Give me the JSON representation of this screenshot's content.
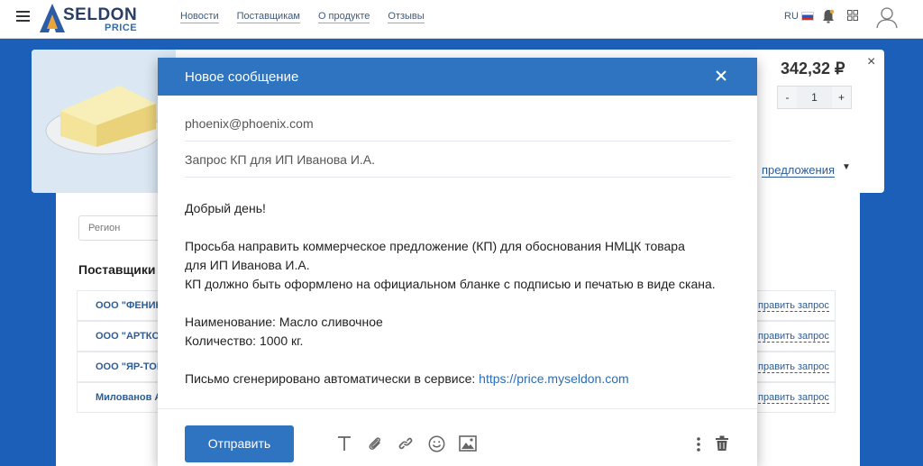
{
  "header": {
    "logo_name": "SELDON",
    "logo_sub": "PRICE",
    "nav": [
      "Новости",
      "Поставщикам",
      "О продукте",
      "Отзывы"
    ],
    "lang": "RU"
  },
  "product": {
    "price": "342,32 ₽",
    "quantity": "1",
    "minus": "-",
    "plus": "+",
    "offers_link": "предложения",
    "close_glyph": "×"
  },
  "filters": {
    "region_placeholder": "Регион"
  },
  "suppliers": {
    "title": "Поставщики",
    "rows": [
      {
        "name": "ООО \"ФЕНИК",
        "action": "править запрос"
      },
      {
        "name": "ООО \"АРТКО",
        "action": "править запрос"
      },
      {
        "name": "ООО \"ЯР-ТОР",
        "action": "править запрос"
      },
      {
        "name": "Милованов А",
        "action": "править запрос"
      }
    ]
  },
  "modal": {
    "title": "Новое сообщение",
    "to": "phoenix@phoenix.com",
    "subject": "Запрос КП для ИП Иванова И.А.",
    "greeting": "Добрый день!",
    "para1_line1": "Просьба направить коммерческое предложение (КП) для обоснования НМЦК товара",
    "para1_line2": "для ИП Иванова И.А.",
    "para1_line3": "КП должно быть оформлено на официальном бланке с подписью и печатью в виде скана.",
    "item_name": "Наименование: Масло сливочное",
    "item_qty": "Количество: 1000 кг.",
    "footer_text": "Письмо сгенерировано автоматически в сервисе: ",
    "footer_link": "https://price.myseldon.com",
    "send_label": "Отправить"
  },
  "colors": {
    "accent": "#2e74c0",
    "page_bg": "#1c5fb8"
  }
}
